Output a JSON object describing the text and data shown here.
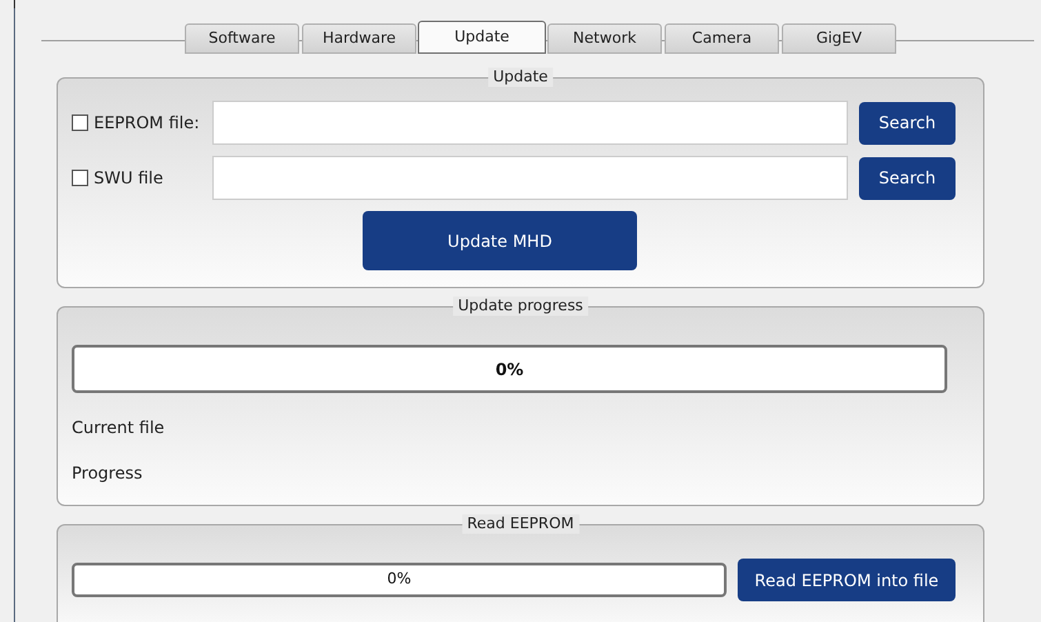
{
  "tabs": [
    {
      "label": "Software",
      "selected": false
    },
    {
      "label": "Hardware",
      "selected": false
    },
    {
      "label": "Update",
      "selected": true
    },
    {
      "label": "Network",
      "selected": false
    },
    {
      "label": "Camera",
      "selected": false
    },
    {
      "label": "GigEV",
      "selected": false
    }
  ],
  "update": {
    "title": "Update",
    "files": [
      {
        "label": "EEPROM file:",
        "checked": false,
        "button": "Search"
      },
      {
        "label": "SWU file",
        "checked": false,
        "button": "Search"
      }
    ],
    "button": "Update MHD"
  },
  "update_progress": {
    "title": "Update progress",
    "level": 0,
    "reading": "0%",
    "current_file": "Current file",
    "progress": "Progress"
  },
  "read_eeprom": {
    "title": "Read EEPROM",
    "level": 0,
    "reading": "0%",
    "button": "Read EEPROM into file"
  }
}
